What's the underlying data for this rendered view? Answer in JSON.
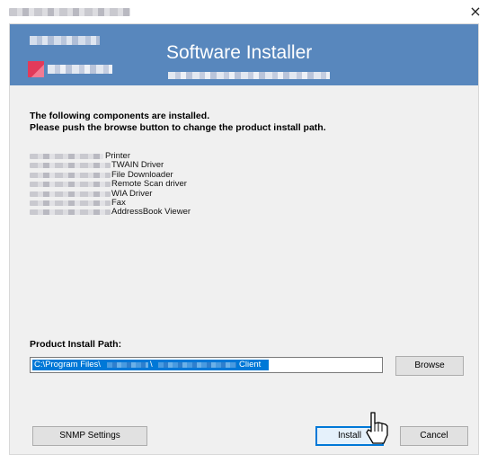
{
  "window": {
    "close_glyph": "×"
  },
  "banner": {
    "title": "Software Installer",
    "accent_color": "#5887bd",
    "logo_color": "#e23a5a"
  },
  "intro": {
    "line1": "The following components are installed.",
    "line2": "Please push the browse button to change the product install path."
  },
  "components": [
    {
      "label": "Printer"
    },
    {
      "label": "TWAIN Driver"
    },
    {
      "label": "File Downloader"
    },
    {
      "label": "Remote Scan driver"
    },
    {
      "label": "WIA Driver"
    },
    {
      "label": "Fax"
    },
    {
      "label": "AddressBook Viewer"
    }
  ],
  "install_path": {
    "label": "Product Install Path:",
    "value_prefix": "C:\\Program Files\\",
    "value_separator": "\\",
    "value_suffix": "Client"
  },
  "buttons": {
    "browse": "Browse",
    "snmp": "SNMP Settings",
    "install": "Install",
    "cancel": "Cancel"
  },
  "icons": {
    "cursor": "pointer-cursor-icon",
    "close": "close-icon"
  }
}
